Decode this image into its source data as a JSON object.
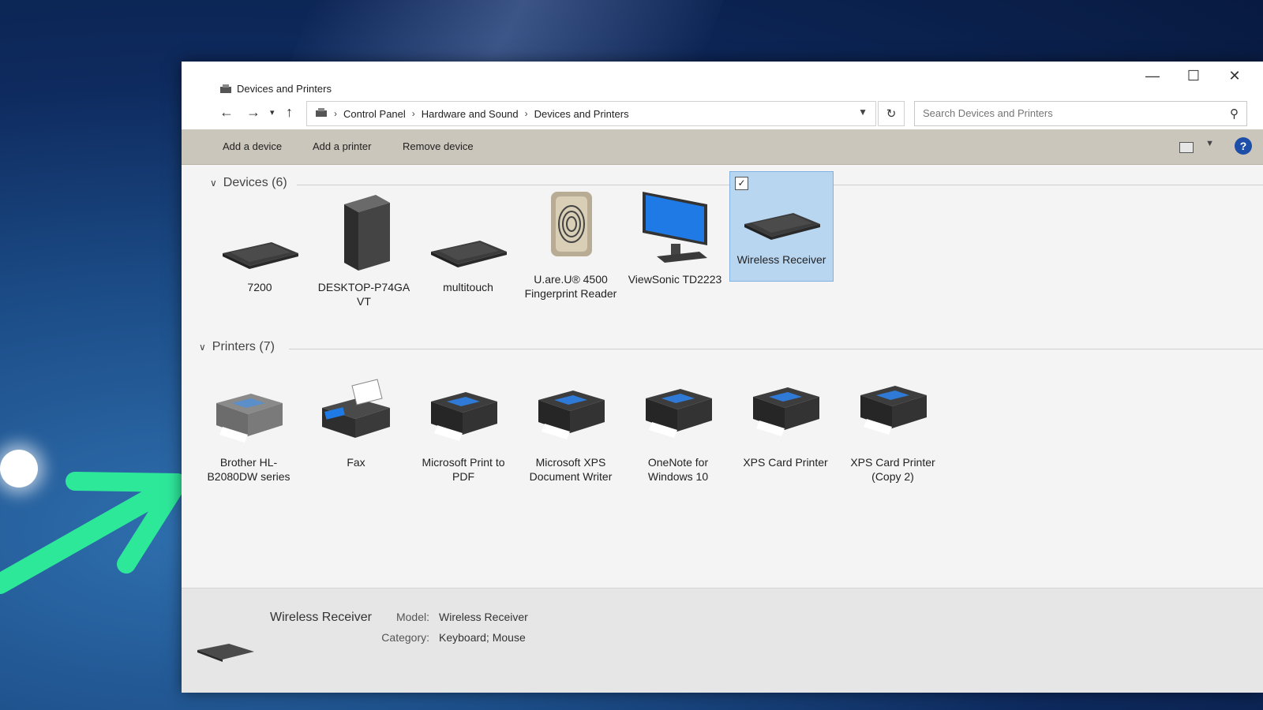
{
  "window": {
    "title": "Devices and Printers"
  },
  "breadcrumb": [
    "Control Panel",
    "Hardware and Sound",
    "Devices and Printers"
  ],
  "search": {
    "placeholder": "Search Devices and Printers"
  },
  "commands": {
    "add_device": "Add a device",
    "add_printer": "Add a printer",
    "remove_device": "Remove device"
  },
  "groups": {
    "devices": {
      "label": "Devices (6)",
      "items": [
        {
          "label": "7200",
          "icon": "keyboard-icon"
        },
        {
          "label": "DESKTOP-P74GA VT",
          "icon": "computer-tower-icon"
        },
        {
          "label": "multitouch",
          "icon": "keyboard-icon"
        },
        {
          "label": "U.are.U® 4500 Fingerprint Reader",
          "icon": "fingerprint-reader-icon"
        },
        {
          "label": "ViewSonic TD2223",
          "icon": "monitor-icon"
        },
        {
          "label": "Wireless Receiver",
          "icon": "keyboard-icon",
          "selected": true
        }
      ]
    },
    "printers": {
      "label": "Printers (7)",
      "items": [
        {
          "label": "Brother HL-B2080DW series",
          "icon": "printer-icon"
        },
        {
          "label": "Fax",
          "icon": "fax-icon"
        },
        {
          "label": "Microsoft Print to PDF",
          "icon": "printer-icon"
        },
        {
          "label": "Microsoft XPS Document Writer",
          "icon": "printer-icon"
        },
        {
          "label": "OneNote for Windows 10",
          "icon": "printer-icon"
        },
        {
          "label": "XPS Card Printer",
          "icon": "printer-icon"
        },
        {
          "label": "XPS Card Printer (Copy 2)",
          "icon": "printer-icon"
        }
      ]
    }
  },
  "details": {
    "name": "Wireless Receiver",
    "model_label": "Model:",
    "model_value": "Wireless Receiver",
    "category_label": "Category:",
    "category_value": "Keyboard; Mouse"
  },
  "colors": {
    "selection": "#b9d6f1",
    "command_bar": "#cbc6bb",
    "arrow": "#2ee89a"
  }
}
